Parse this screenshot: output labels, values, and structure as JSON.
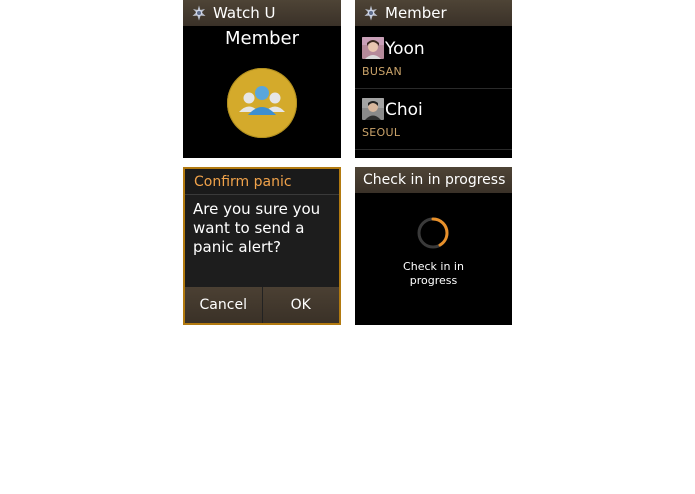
{
  "screen_home": {
    "app_title": "Watch U",
    "heading": "Member",
    "icon": "members-group-icon",
    "accent": "#d4aa2b"
  },
  "screen_members": {
    "title": "Member",
    "members": [
      {
        "name": "Yoon",
        "city": "BUSAN"
      },
      {
        "name": "Choi",
        "city": "SEOUL"
      }
    ]
  },
  "screen_confirm": {
    "title": "Confirm panic",
    "message": "Are you sure you want to send a panic alert?",
    "cancel_label": "Cancel",
    "ok_label": "OK",
    "accent": "#f0a24a"
  },
  "screen_checkin": {
    "title": "Check in in progress",
    "status": "Check in in progress",
    "spinner_color": "#e8902a"
  }
}
